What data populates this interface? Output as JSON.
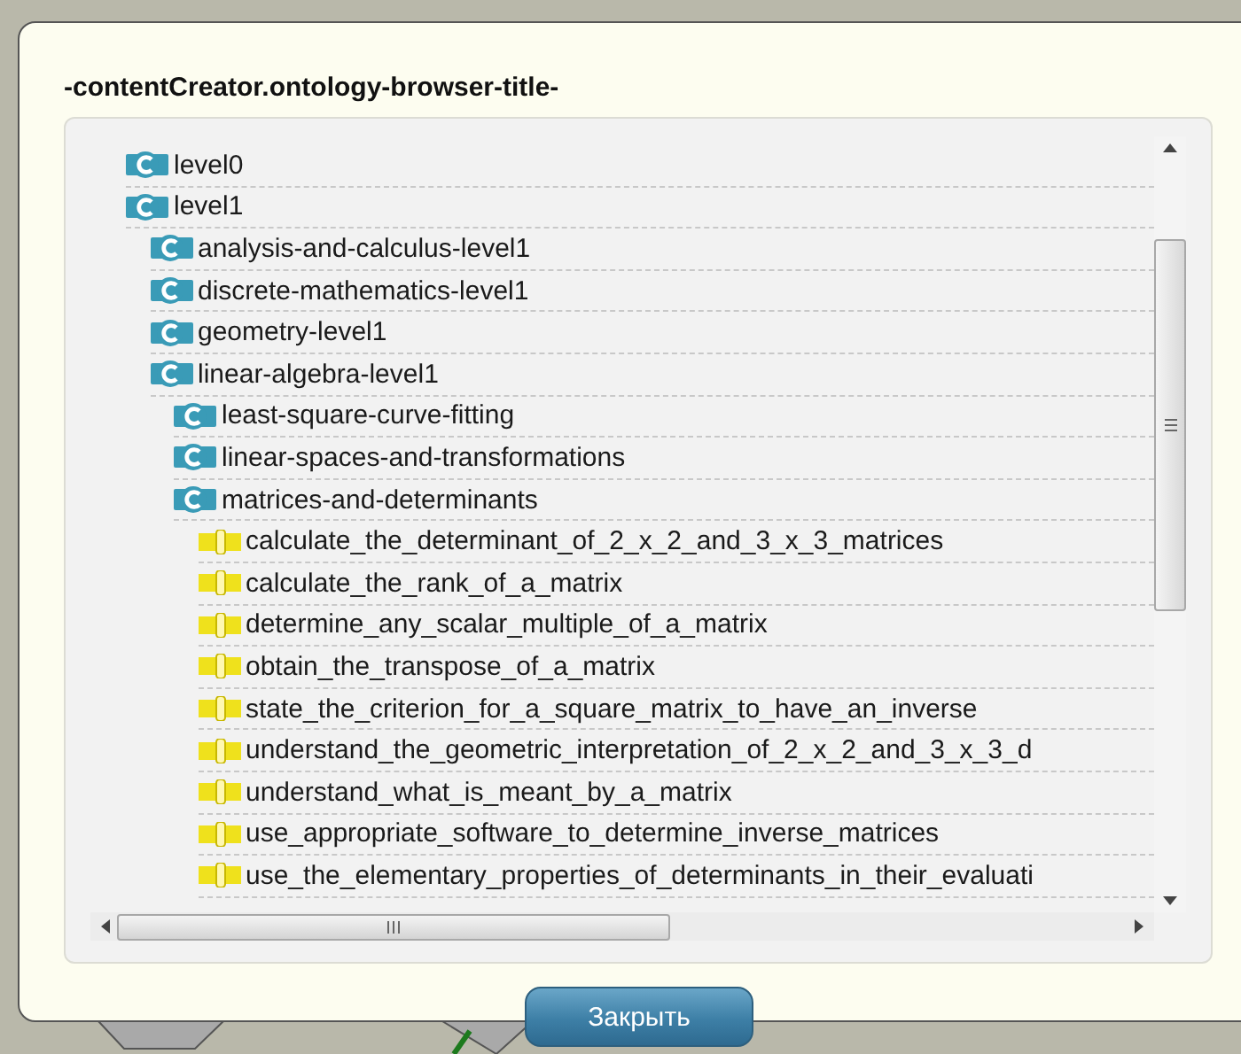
{
  "dialog": {
    "title": "-contentCreator.ontology-browser-title-",
    "tree": [
      {
        "kind": "class",
        "label": "level0"
      },
      {
        "kind": "class",
        "label": "level1",
        "children": [
          {
            "kind": "class",
            "label": "analysis-and-calculus-level1"
          },
          {
            "kind": "class",
            "label": "discrete-mathematics-level1"
          },
          {
            "kind": "class",
            "label": "geometry-level1"
          },
          {
            "kind": "class",
            "label": "linear-algebra-level1",
            "children": [
              {
                "kind": "class",
                "label": "least-square-curve-fitting"
              },
              {
                "kind": "class",
                "label": "linear-spaces-and-transformations"
              },
              {
                "kind": "class",
                "label": "matrices-and-determinants",
                "children": [
                  {
                    "kind": "individual",
                    "label": "calculate_the_determinant_of_2_x_2_and_3_x_3_matrices"
                  },
                  {
                    "kind": "individual",
                    "label": "calculate_the_rank_of_a_matrix"
                  },
                  {
                    "kind": "individual",
                    "label": "determine_any_scalar_multiple_of_a_matrix"
                  },
                  {
                    "kind": "individual",
                    "label": "obtain_the_transpose_of_a_matrix"
                  },
                  {
                    "kind": "individual",
                    "label": "state_the_criterion_for_a_square_matrix_to_have_an_inverse"
                  },
                  {
                    "kind": "individual",
                    "label": "understand_the_geometric_interpretation_of_2_x_2_and_3_x_3_d"
                  },
                  {
                    "kind": "individual",
                    "label": "understand_what_is_meant_by_a_matrix"
                  },
                  {
                    "kind": "individual",
                    "label": "use_appropriate_software_to_determine_inverse_matrices"
                  },
                  {
                    "kind": "individual",
                    "label": "use_the_elementary_properties_of_determinants_in_their_evaluati"
                  }
                ]
              }
            ]
          }
        ]
      }
    ],
    "button": "Закрыть"
  }
}
